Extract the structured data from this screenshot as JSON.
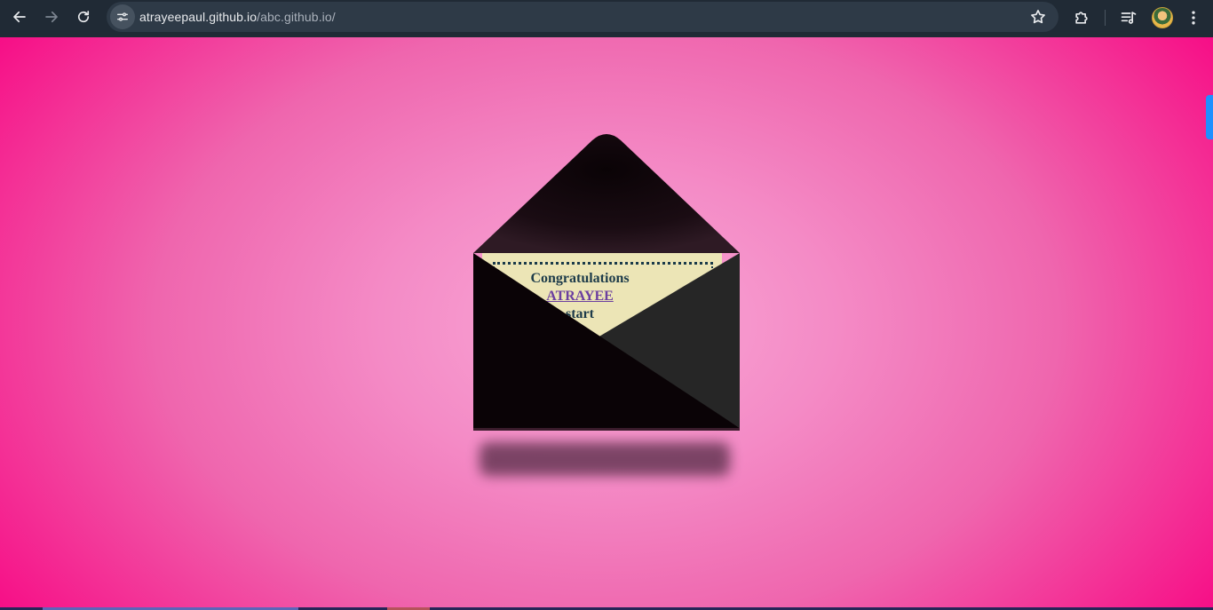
{
  "browser": {
    "url_host": "atrayeepaul.github.io",
    "url_path": "/abc.github.io/",
    "icons": {
      "back": "arrow-left-icon",
      "forward": "arrow-right-icon",
      "reload": "reload-icon",
      "site_info": "tune-icon",
      "bookmark": "star-icon",
      "extensions": "puzzle-icon",
      "media": "media-queue-icon",
      "profile": "avatar",
      "menu": "kebab-menu-icon"
    }
  },
  "letter": {
    "line1": "Congratulations",
    "name": "ATRAYEE",
    "line3": "start"
  },
  "colors": {
    "chrome_bg": "#202a35",
    "page_center": "#f9a8d6",
    "page_edge": "#f70b85",
    "envelope_dark": "#0a0306",
    "envelope_side": "#262626",
    "letter_paper": "#ece5b6",
    "letter_text": "#1d3b4a",
    "link": "#6b3fa0"
  }
}
